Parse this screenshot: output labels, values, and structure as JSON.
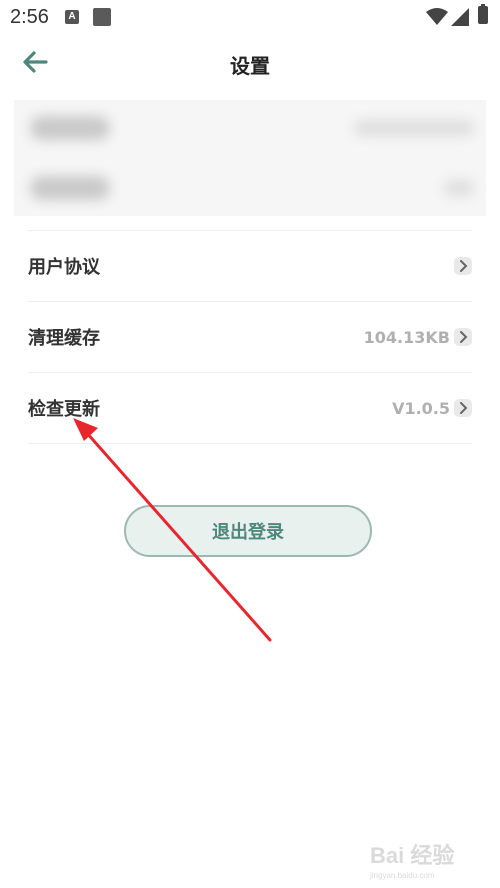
{
  "status_bar": {
    "time": "2:56",
    "a_icon_letter": "A"
  },
  "header": {
    "title": "设置"
  },
  "settings": {
    "rows": [
      {
        "label": "用户协议",
        "value": ""
      },
      {
        "label": "清理缓存",
        "value": "104.13KB"
      },
      {
        "label": "检查更新",
        "value": "V1.0.5"
      }
    ]
  },
  "logout_label": "退出登录",
  "watermark": {
    "text": "Bai 经验",
    "sub": "jingyan.baidu.com"
  },
  "colors": {
    "accent": "#4f877c",
    "annotation": "#e8262d"
  }
}
